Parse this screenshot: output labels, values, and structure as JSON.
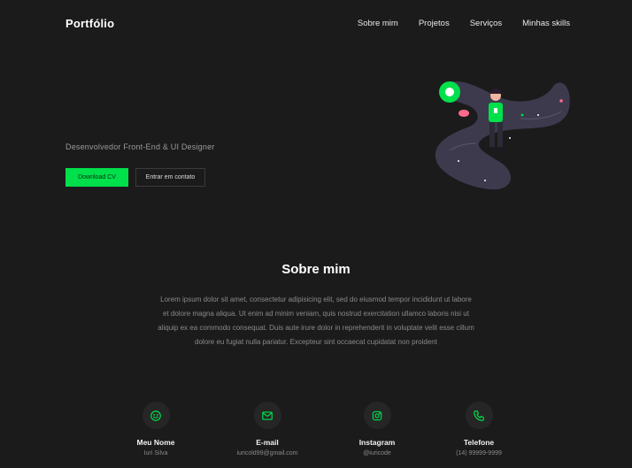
{
  "header": {
    "brand": "Portfólio",
    "nav": [
      "Sobre mim",
      "Projetos",
      "Serviços",
      "Minhas skills"
    ]
  },
  "hero": {
    "subtitle": "Desenvolvedor Front-End & UI Designer",
    "primary_button": "Download CV",
    "secondary_button": "Entrar em contato"
  },
  "about": {
    "title": "Sobre mim",
    "text": "Lorem ipsum dolor sit amet, consectetur adipisicing elit, sed do eiusmod tempor incididunt ut labore et dolore magna aliqua. Ut enim ad minim veniam, quis nostrud exercitation ullamco laboris nisi ut aliquip ex ea commodo consequat. Duis aute irure dolor in reprehenderit in voluptate velit esse cillum dolore eu fugiat nulla pariatur. Excepteur sint occaecat cupidatat non proident"
  },
  "contacts": [
    {
      "label": "Meu Nome",
      "value": "Iuri Silva",
      "icon": "smiley-icon"
    },
    {
      "label": "E-mail",
      "value": "iuricold99@gmail.com",
      "icon": "mail-icon"
    },
    {
      "label": "Instagram",
      "value": "@iuricode",
      "icon": "instagram-icon"
    },
    {
      "label": "Telefone",
      "value": "(14) 99999-9999",
      "icon": "phone-icon"
    }
  ],
  "colors": {
    "background": "#1b1b1b",
    "accent": "#00e04b",
    "muted_text": "#8a8a8a"
  }
}
